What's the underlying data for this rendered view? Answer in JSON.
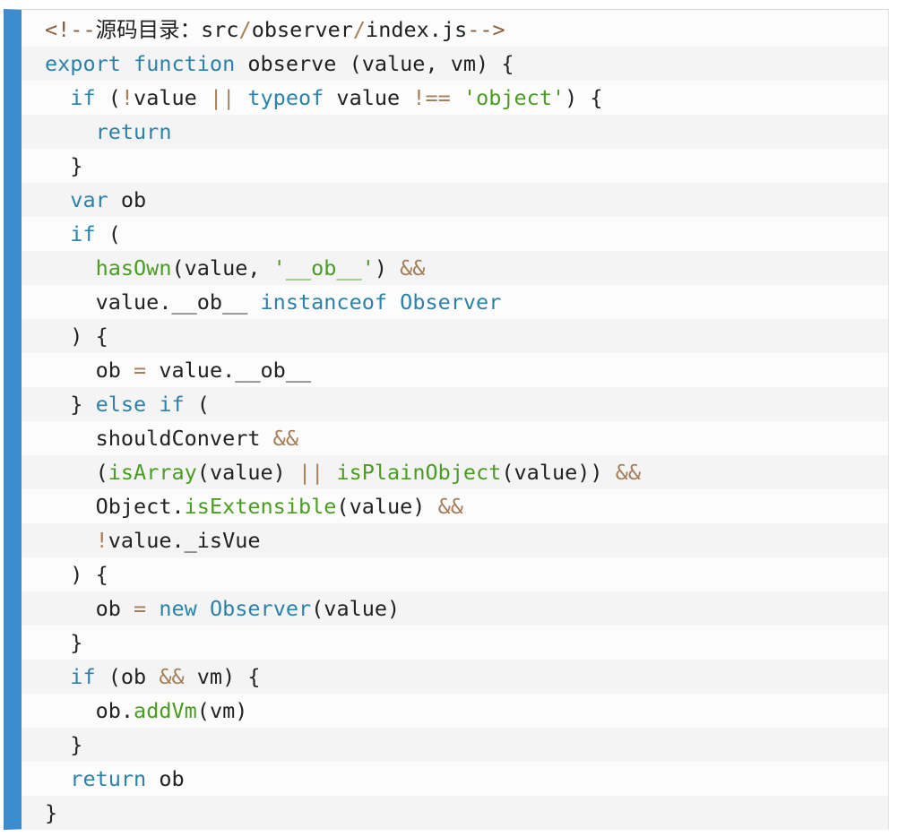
{
  "colors": {
    "gutter": "#3a8ccf",
    "background": "#fcfcfc",
    "stripe": "#f4f4f4",
    "keyword": "#2c82a8",
    "operator": "#a67f59",
    "function": "#4a9d22",
    "string": "#4a9d22",
    "class": "#2c82a8",
    "comment": "#8a5f3c",
    "text": "#222222"
  },
  "code": {
    "language": "javascript",
    "lines": [
      {
        "tokens": [
          {
            "t": "com",
            "v": "<!--"
          },
          {
            "t": "txt",
            "v": "源码目录：src"
          },
          {
            "t": "op",
            "v": "/"
          },
          {
            "t": "txt",
            "v": "observer"
          },
          {
            "t": "op",
            "v": "/"
          },
          {
            "t": "txt",
            "v": "index.js"
          },
          {
            "t": "com",
            "v": "-->"
          }
        ]
      },
      {
        "tokens": [
          {
            "t": "kw",
            "v": "export"
          },
          {
            "t": "txt",
            "v": " "
          },
          {
            "t": "kw",
            "v": "function"
          },
          {
            "t": "txt",
            "v": " observe (value, vm) {"
          }
        ]
      },
      {
        "tokens": [
          {
            "t": "txt",
            "v": "  "
          },
          {
            "t": "kw",
            "v": "if"
          },
          {
            "t": "txt",
            "v": " ("
          },
          {
            "t": "op",
            "v": "!"
          },
          {
            "t": "txt",
            "v": "value "
          },
          {
            "t": "op",
            "v": "||"
          },
          {
            "t": "txt",
            "v": " "
          },
          {
            "t": "kw",
            "v": "typeof"
          },
          {
            "t": "txt",
            "v": " value "
          },
          {
            "t": "op",
            "v": "!=="
          },
          {
            "t": "txt",
            "v": " "
          },
          {
            "t": "str",
            "v": "'object'"
          },
          {
            "t": "txt",
            "v": ") {"
          }
        ]
      },
      {
        "tokens": [
          {
            "t": "txt",
            "v": "    "
          },
          {
            "t": "kw",
            "v": "return"
          }
        ]
      },
      {
        "tokens": [
          {
            "t": "txt",
            "v": "  }"
          }
        ]
      },
      {
        "tokens": [
          {
            "t": "txt",
            "v": "  "
          },
          {
            "t": "kw",
            "v": "var"
          },
          {
            "t": "txt",
            "v": " ob"
          }
        ]
      },
      {
        "tokens": [
          {
            "t": "txt",
            "v": "  "
          },
          {
            "t": "kw",
            "v": "if"
          },
          {
            "t": "txt",
            "v": " ("
          }
        ]
      },
      {
        "tokens": [
          {
            "t": "txt",
            "v": "    "
          },
          {
            "t": "fn",
            "v": "hasOwn"
          },
          {
            "t": "txt",
            "v": "(value, "
          },
          {
            "t": "str",
            "v": "'__ob__'"
          },
          {
            "t": "txt",
            "v": ") "
          },
          {
            "t": "op",
            "v": "&&"
          }
        ]
      },
      {
        "tokens": [
          {
            "t": "txt",
            "v": "    value.__ob__ "
          },
          {
            "t": "kw",
            "v": "instanceof"
          },
          {
            "t": "txt",
            "v": " "
          },
          {
            "t": "cls",
            "v": "Observer"
          }
        ]
      },
      {
        "tokens": [
          {
            "t": "txt",
            "v": "  ) {"
          }
        ]
      },
      {
        "tokens": [
          {
            "t": "txt",
            "v": "    ob "
          },
          {
            "t": "op",
            "v": "="
          },
          {
            "t": "txt",
            "v": " value.__ob__"
          }
        ]
      },
      {
        "tokens": [
          {
            "t": "txt",
            "v": "  } "
          },
          {
            "t": "kw",
            "v": "else"
          },
          {
            "t": "txt",
            "v": " "
          },
          {
            "t": "kw",
            "v": "if"
          },
          {
            "t": "txt",
            "v": " ("
          }
        ]
      },
      {
        "tokens": [
          {
            "t": "txt",
            "v": "    shouldConvert "
          },
          {
            "t": "op",
            "v": "&&"
          }
        ]
      },
      {
        "tokens": [
          {
            "t": "txt",
            "v": "    ("
          },
          {
            "t": "fn",
            "v": "isArray"
          },
          {
            "t": "txt",
            "v": "(value) "
          },
          {
            "t": "op",
            "v": "||"
          },
          {
            "t": "txt",
            "v": " "
          },
          {
            "t": "fn",
            "v": "isPlainObject"
          },
          {
            "t": "txt",
            "v": "(value)) "
          },
          {
            "t": "op",
            "v": "&&"
          }
        ]
      },
      {
        "tokens": [
          {
            "t": "txt",
            "v": "    Object."
          },
          {
            "t": "fn",
            "v": "isExtensible"
          },
          {
            "t": "txt",
            "v": "(value) "
          },
          {
            "t": "op",
            "v": "&&"
          }
        ]
      },
      {
        "tokens": [
          {
            "t": "txt",
            "v": "    "
          },
          {
            "t": "op",
            "v": "!"
          },
          {
            "t": "txt",
            "v": "value._isVue"
          }
        ]
      },
      {
        "tokens": [
          {
            "t": "txt",
            "v": "  ) {"
          }
        ]
      },
      {
        "tokens": [
          {
            "t": "txt",
            "v": "    ob "
          },
          {
            "t": "op",
            "v": "="
          },
          {
            "t": "txt",
            "v": " "
          },
          {
            "t": "kw",
            "v": "new"
          },
          {
            "t": "txt",
            "v": " "
          },
          {
            "t": "cls",
            "v": "Observer"
          },
          {
            "t": "txt",
            "v": "(value)"
          }
        ]
      },
      {
        "tokens": [
          {
            "t": "txt",
            "v": "  }"
          }
        ]
      },
      {
        "tokens": [
          {
            "t": "txt",
            "v": "  "
          },
          {
            "t": "kw",
            "v": "if"
          },
          {
            "t": "txt",
            "v": " (ob "
          },
          {
            "t": "op",
            "v": "&&"
          },
          {
            "t": "txt",
            "v": " vm) {"
          }
        ]
      },
      {
        "tokens": [
          {
            "t": "txt",
            "v": "    ob."
          },
          {
            "t": "fn",
            "v": "addVm"
          },
          {
            "t": "txt",
            "v": "(vm)"
          }
        ]
      },
      {
        "tokens": [
          {
            "t": "txt",
            "v": "  }"
          }
        ]
      },
      {
        "tokens": [
          {
            "t": "txt",
            "v": "  "
          },
          {
            "t": "kw",
            "v": "return"
          },
          {
            "t": "txt",
            "v": " ob"
          }
        ]
      },
      {
        "tokens": [
          {
            "t": "txt",
            "v": "}"
          }
        ]
      }
    ]
  }
}
